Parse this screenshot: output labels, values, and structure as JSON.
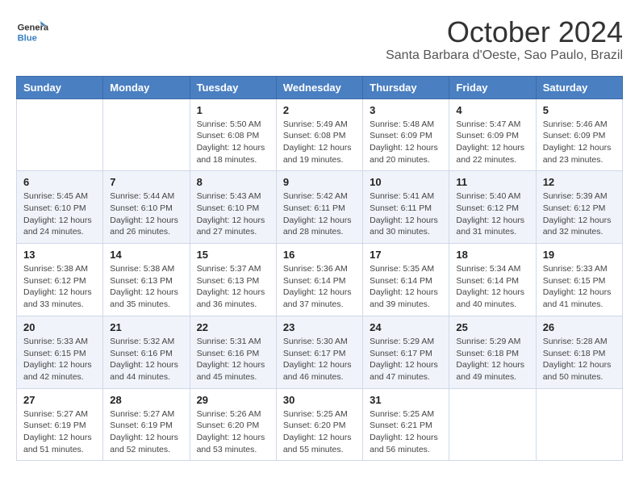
{
  "header": {
    "logo_general": "General",
    "logo_blue": "Blue",
    "month_title": "October 2024",
    "location": "Santa Barbara d'Oeste, Sao Paulo, Brazil"
  },
  "days_of_week": [
    "Sunday",
    "Monday",
    "Tuesday",
    "Wednesday",
    "Thursday",
    "Friday",
    "Saturday"
  ],
  "weeks": [
    [
      {
        "day": "",
        "sunrise": "",
        "sunset": "",
        "daylight": ""
      },
      {
        "day": "",
        "sunrise": "",
        "sunset": "",
        "daylight": ""
      },
      {
        "day": "1",
        "sunrise": "Sunrise: 5:50 AM",
        "sunset": "Sunset: 6:08 PM",
        "daylight": "Daylight: 12 hours and 18 minutes."
      },
      {
        "day": "2",
        "sunrise": "Sunrise: 5:49 AM",
        "sunset": "Sunset: 6:08 PM",
        "daylight": "Daylight: 12 hours and 19 minutes."
      },
      {
        "day": "3",
        "sunrise": "Sunrise: 5:48 AM",
        "sunset": "Sunset: 6:09 PM",
        "daylight": "Daylight: 12 hours and 20 minutes."
      },
      {
        "day": "4",
        "sunrise": "Sunrise: 5:47 AM",
        "sunset": "Sunset: 6:09 PM",
        "daylight": "Daylight: 12 hours and 22 minutes."
      },
      {
        "day": "5",
        "sunrise": "Sunrise: 5:46 AM",
        "sunset": "Sunset: 6:09 PM",
        "daylight": "Daylight: 12 hours and 23 minutes."
      }
    ],
    [
      {
        "day": "6",
        "sunrise": "Sunrise: 5:45 AM",
        "sunset": "Sunset: 6:10 PM",
        "daylight": "Daylight: 12 hours and 24 minutes."
      },
      {
        "day": "7",
        "sunrise": "Sunrise: 5:44 AM",
        "sunset": "Sunset: 6:10 PM",
        "daylight": "Daylight: 12 hours and 26 minutes."
      },
      {
        "day": "8",
        "sunrise": "Sunrise: 5:43 AM",
        "sunset": "Sunset: 6:10 PM",
        "daylight": "Daylight: 12 hours and 27 minutes."
      },
      {
        "day": "9",
        "sunrise": "Sunrise: 5:42 AM",
        "sunset": "Sunset: 6:11 PM",
        "daylight": "Daylight: 12 hours and 28 minutes."
      },
      {
        "day": "10",
        "sunrise": "Sunrise: 5:41 AM",
        "sunset": "Sunset: 6:11 PM",
        "daylight": "Daylight: 12 hours and 30 minutes."
      },
      {
        "day": "11",
        "sunrise": "Sunrise: 5:40 AM",
        "sunset": "Sunset: 6:12 PM",
        "daylight": "Daylight: 12 hours and 31 minutes."
      },
      {
        "day": "12",
        "sunrise": "Sunrise: 5:39 AM",
        "sunset": "Sunset: 6:12 PM",
        "daylight": "Daylight: 12 hours and 32 minutes."
      }
    ],
    [
      {
        "day": "13",
        "sunrise": "Sunrise: 5:38 AM",
        "sunset": "Sunset: 6:12 PM",
        "daylight": "Daylight: 12 hours and 33 minutes."
      },
      {
        "day": "14",
        "sunrise": "Sunrise: 5:38 AM",
        "sunset": "Sunset: 6:13 PM",
        "daylight": "Daylight: 12 hours and 35 minutes."
      },
      {
        "day": "15",
        "sunrise": "Sunrise: 5:37 AM",
        "sunset": "Sunset: 6:13 PM",
        "daylight": "Daylight: 12 hours and 36 minutes."
      },
      {
        "day": "16",
        "sunrise": "Sunrise: 5:36 AM",
        "sunset": "Sunset: 6:14 PM",
        "daylight": "Daylight: 12 hours and 37 minutes."
      },
      {
        "day": "17",
        "sunrise": "Sunrise: 5:35 AM",
        "sunset": "Sunset: 6:14 PM",
        "daylight": "Daylight: 12 hours and 39 minutes."
      },
      {
        "day": "18",
        "sunrise": "Sunrise: 5:34 AM",
        "sunset": "Sunset: 6:14 PM",
        "daylight": "Daylight: 12 hours and 40 minutes."
      },
      {
        "day": "19",
        "sunrise": "Sunrise: 5:33 AM",
        "sunset": "Sunset: 6:15 PM",
        "daylight": "Daylight: 12 hours and 41 minutes."
      }
    ],
    [
      {
        "day": "20",
        "sunrise": "Sunrise: 5:33 AM",
        "sunset": "Sunset: 6:15 PM",
        "daylight": "Daylight: 12 hours and 42 minutes."
      },
      {
        "day": "21",
        "sunrise": "Sunrise: 5:32 AM",
        "sunset": "Sunset: 6:16 PM",
        "daylight": "Daylight: 12 hours and 44 minutes."
      },
      {
        "day": "22",
        "sunrise": "Sunrise: 5:31 AM",
        "sunset": "Sunset: 6:16 PM",
        "daylight": "Daylight: 12 hours and 45 minutes."
      },
      {
        "day": "23",
        "sunrise": "Sunrise: 5:30 AM",
        "sunset": "Sunset: 6:17 PM",
        "daylight": "Daylight: 12 hours and 46 minutes."
      },
      {
        "day": "24",
        "sunrise": "Sunrise: 5:29 AM",
        "sunset": "Sunset: 6:17 PM",
        "daylight": "Daylight: 12 hours and 47 minutes."
      },
      {
        "day": "25",
        "sunrise": "Sunrise: 5:29 AM",
        "sunset": "Sunset: 6:18 PM",
        "daylight": "Daylight: 12 hours and 49 minutes."
      },
      {
        "day": "26",
        "sunrise": "Sunrise: 5:28 AM",
        "sunset": "Sunset: 6:18 PM",
        "daylight": "Daylight: 12 hours and 50 minutes."
      }
    ],
    [
      {
        "day": "27",
        "sunrise": "Sunrise: 5:27 AM",
        "sunset": "Sunset: 6:19 PM",
        "daylight": "Daylight: 12 hours and 51 minutes."
      },
      {
        "day": "28",
        "sunrise": "Sunrise: 5:27 AM",
        "sunset": "Sunset: 6:19 PM",
        "daylight": "Daylight: 12 hours and 52 minutes."
      },
      {
        "day": "29",
        "sunrise": "Sunrise: 5:26 AM",
        "sunset": "Sunset: 6:20 PM",
        "daylight": "Daylight: 12 hours and 53 minutes."
      },
      {
        "day": "30",
        "sunrise": "Sunrise: 5:25 AM",
        "sunset": "Sunset: 6:20 PM",
        "daylight": "Daylight: 12 hours and 55 minutes."
      },
      {
        "day": "31",
        "sunrise": "Sunrise: 5:25 AM",
        "sunset": "Sunset: 6:21 PM",
        "daylight": "Daylight: 12 hours and 56 minutes."
      },
      {
        "day": "",
        "sunrise": "",
        "sunset": "",
        "daylight": ""
      },
      {
        "day": "",
        "sunrise": "",
        "sunset": "",
        "daylight": ""
      }
    ]
  ]
}
